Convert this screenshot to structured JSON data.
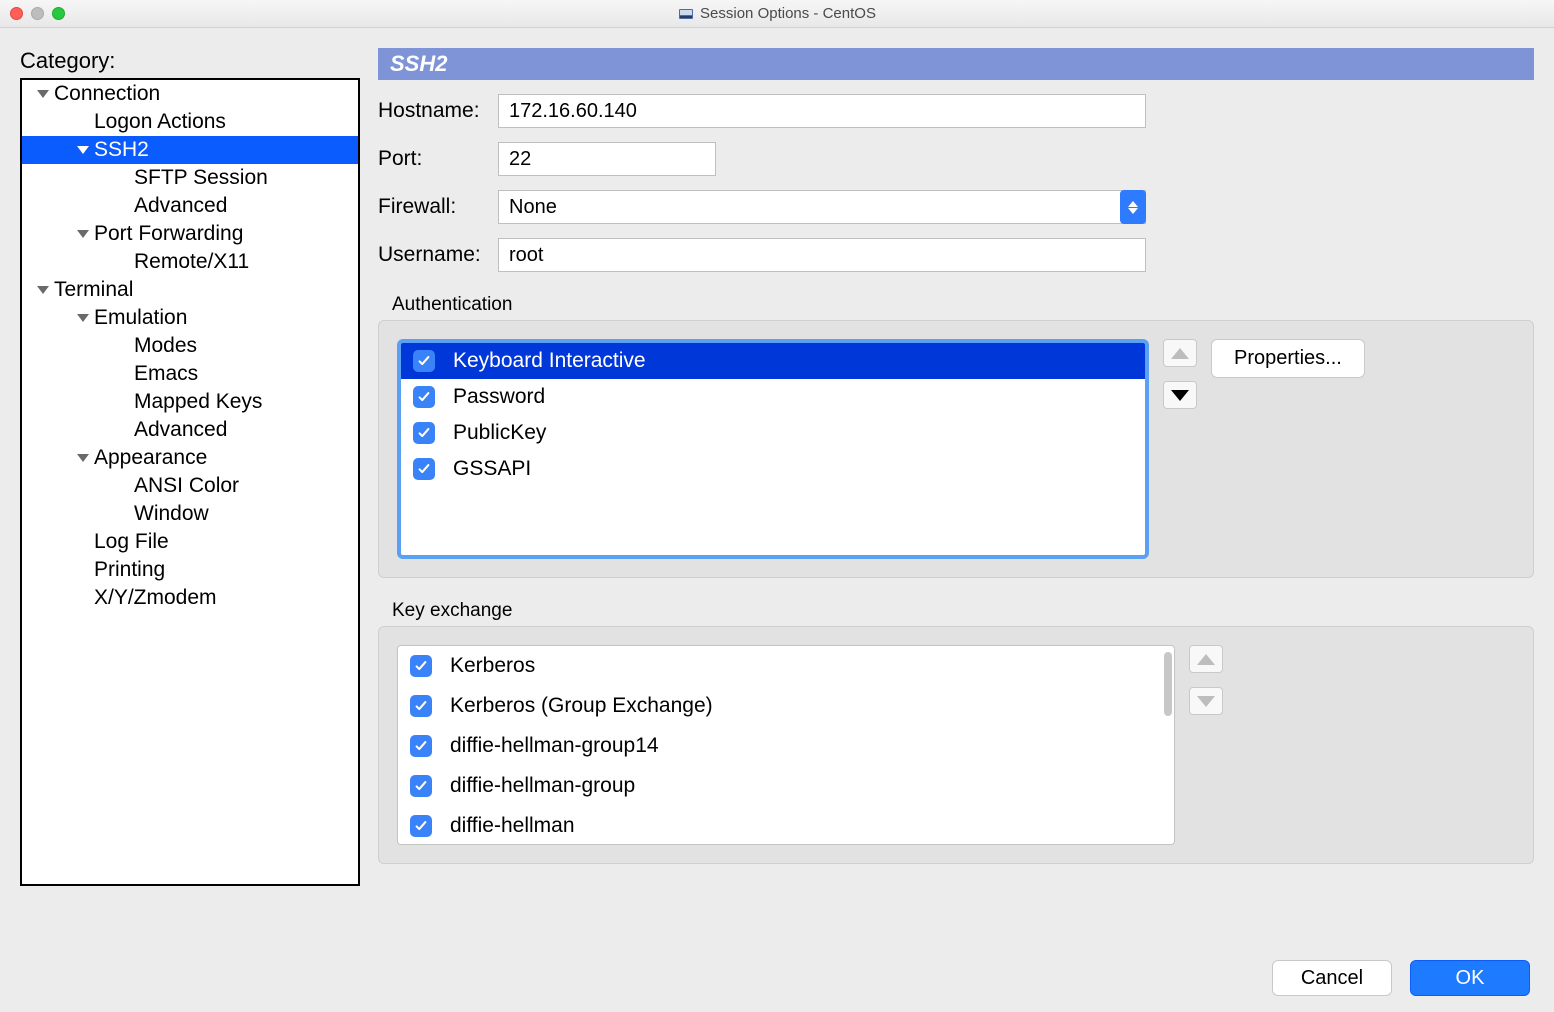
{
  "window": {
    "title": "Session Options - CentOS"
  },
  "sidebar": {
    "heading": "Category:",
    "tree": [
      {
        "label": "Connection",
        "indent": 0,
        "arrow": true
      },
      {
        "label": "Logon Actions",
        "indent": 1,
        "arrow": false
      },
      {
        "label": "SSH2",
        "indent": 1,
        "arrow": true,
        "selected": true
      },
      {
        "label": "SFTP Session",
        "indent": 2,
        "arrow": false
      },
      {
        "label": "Advanced",
        "indent": 2,
        "arrow": false
      },
      {
        "label": "Port Forwarding",
        "indent": 1,
        "arrow": true
      },
      {
        "label": "Remote/X11",
        "indent": 2,
        "arrow": false
      },
      {
        "label": "Terminal",
        "indent": 0,
        "arrow": true
      },
      {
        "label": "Emulation",
        "indent": 1,
        "arrow": true
      },
      {
        "label": "Modes",
        "indent": 2,
        "arrow": false
      },
      {
        "label": "Emacs",
        "indent": 2,
        "arrow": false
      },
      {
        "label": "Mapped Keys",
        "indent": 2,
        "arrow": false
      },
      {
        "label": "Advanced",
        "indent": 2,
        "arrow": false
      },
      {
        "label": "Appearance",
        "indent": 1,
        "arrow": true
      },
      {
        "label": "ANSI Color",
        "indent": 2,
        "arrow": false
      },
      {
        "label": "Window",
        "indent": 2,
        "arrow": false
      },
      {
        "label": "Log File",
        "indent": 1,
        "arrow": false
      },
      {
        "label": "Printing",
        "indent": 1,
        "arrow": false
      },
      {
        "label": "X/Y/Zmodem",
        "indent": 1,
        "arrow": false
      }
    ]
  },
  "panel": {
    "title": "SSH2",
    "hostname_label": "Hostname:",
    "hostname": "172.16.60.140",
    "port_label": "Port:",
    "port": "22",
    "firewall_label": "Firewall:",
    "firewall": "None",
    "username_label": "Username:",
    "username": "root"
  },
  "auth": {
    "heading": "Authentication",
    "properties_btn": "Properties...",
    "items": [
      {
        "label": "Keyboard Interactive",
        "checked": true,
        "selected": true
      },
      {
        "label": "Password",
        "checked": true
      },
      {
        "label": "PublicKey",
        "checked": true
      },
      {
        "label": "GSSAPI",
        "checked": true
      }
    ]
  },
  "kex": {
    "heading": "Key exchange",
    "items": [
      {
        "label": "Kerberos",
        "checked": true
      },
      {
        "label": "Kerberos (Group Exchange)",
        "checked": true
      },
      {
        "label": "diffie-hellman-group14",
        "checked": true
      },
      {
        "label": "diffie-hellman-group",
        "checked": true
      },
      {
        "label": "diffie-hellman",
        "checked": true
      }
    ]
  },
  "footer": {
    "cancel": "Cancel",
    "ok": "OK"
  }
}
